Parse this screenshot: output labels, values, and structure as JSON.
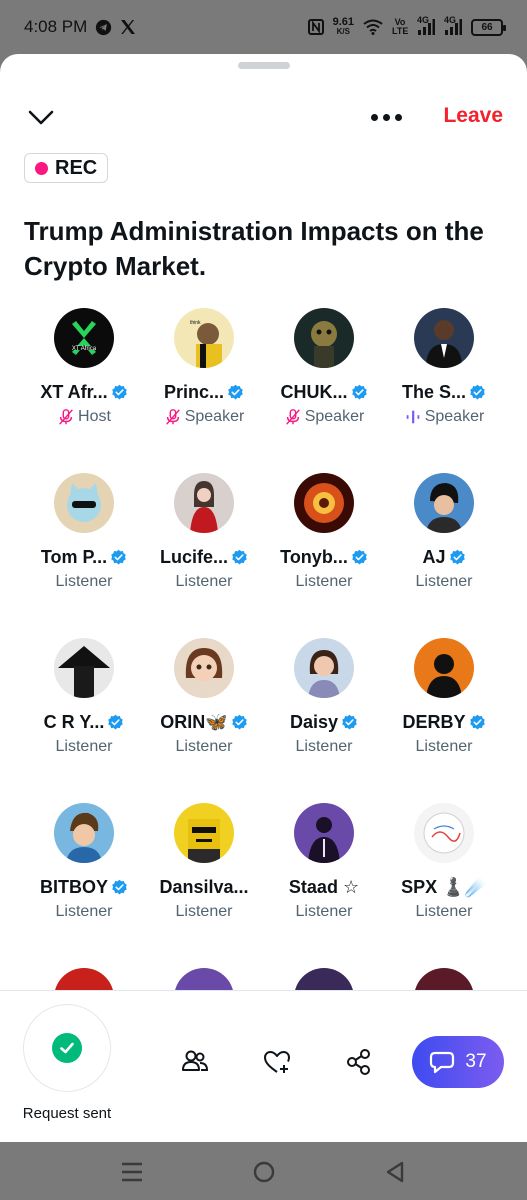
{
  "status_bar": {
    "time": "4:08 PM",
    "speed_value": "9.61",
    "speed_unit": "K/S",
    "volte": "Vo LTE",
    "net1": "4G",
    "net2": "4G",
    "battery": "66",
    "icons": [
      "telegram-icon",
      "x-logo-icon",
      "nfc-icon",
      "wifi-icon",
      "signal-icon",
      "battery-icon"
    ]
  },
  "header": {
    "leave_label": "Leave",
    "rec_label": "REC",
    "title": "Trump Administration Impacts on the Crypto Market."
  },
  "participants": [
    {
      "name": "XT Afr...",
      "role": "Host",
      "verified": true,
      "mic": "muted",
      "avatar": "xt-africa-logo"
    },
    {
      "name": "Princ...",
      "role": "Speaker",
      "verified": true,
      "mic": "muted",
      "avatar": "cartoon-man"
    },
    {
      "name": "CHUK...",
      "role": "Speaker",
      "verified": true,
      "mic": "muted",
      "avatar": "nft-character"
    },
    {
      "name": "The S...",
      "role": "Speaker",
      "verified": true,
      "mic": "speaking",
      "avatar": "man-in-suit"
    },
    {
      "name": "Tom P...",
      "role": "Listener",
      "verified": true,
      "mic": "none",
      "avatar": "cat-cartoon"
    },
    {
      "name": "Lucife...",
      "role": "Listener",
      "verified": true,
      "mic": "none",
      "avatar": "woman-red-dress"
    },
    {
      "name": "Tonyb...",
      "role": "Listener",
      "verified": true,
      "mic": "none",
      "avatar": "fire-character"
    },
    {
      "name": "AJ",
      "role": "Listener",
      "verified": true,
      "mic": "none",
      "avatar": "anime-boy"
    },
    {
      "name": "C R Y...",
      "role": "Listener",
      "verified": true,
      "mic": "none",
      "avatar": "samurai"
    },
    {
      "name": "ORIN🦋",
      "role": "Listener",
      "verified": true,
      "mic": "none",
      "avatar": "cartoon-girl"
    },
    {
      "name": "Daisy",
      "role": "Listener",
      "verified": true,
      "mic": "none",
      "avatar": "woman-photo"
    },
    {
      "name": "DERBY",
      "role": "Listener",
      "verified": true,
      "mic": "none",
      "avatar": "silhouette-orange"
    },
    {
      "name": "BITBOY",
      "role": "Listener",
      "verified": true,
      "mic": "none",
      "avatar": "cartoon-boy"
    },
    {
      "name": "Dansilva...",
      "role": "Listener",
      "verified": false,
      "mic": "none",
      "avatar": "pixel-character"
    },
    {
      "name": "Staad ☆",
      "role": "Listener",
      "verified": false,
      "mic": "none",
      "avatar": "suit-silhouette-purple"
    },
    {
      "name": "SPX ♟️☄️",
      "role": "Listener",
      "verified": false,
      "mic": "none",
      "avatar": "sketch-white"
    }
  ],
  "bottom_bar": {
    "request_label": "Request sent",
    "comments_count": "37",
    "icons": [
      "people-icon",
      "heart-plus-icon",
      "share-icon",
      "comment-icon"
    ]
  },
  "colors": {
    "leave": "#f4212e",
    "verified": "#1d9bf0",
    "rec_dot": "#f91880",
    "check": "#00ba7c",
    "comments_gradient_start": "#3e4bf0",
    "comments_gradient_end": "#7c5cf0"
  }
}
